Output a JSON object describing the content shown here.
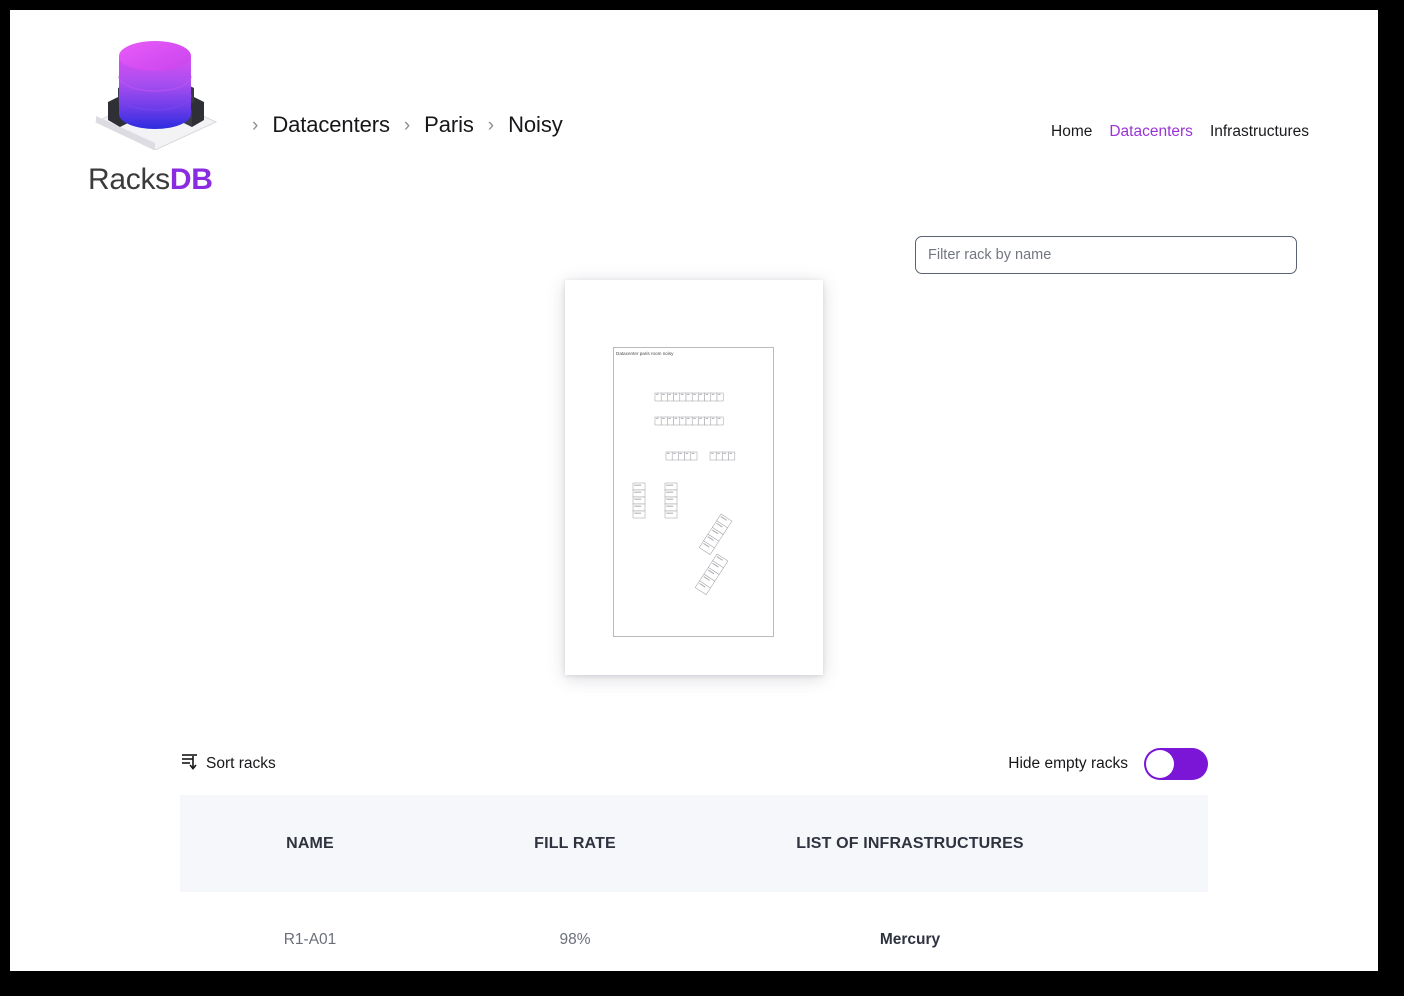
{
  "brand": {
    "name_prefix": "Racks",
    "name_suffix": "DB",
    "logo_icon": "database-cylinder-rack-icon",
    "accent_color": "#8a2be2"
  },
  "breadcrumb": {
    "separator": "›",
    "items": [
      {
        "label": "Datacenters"
      },
      {
        "label": "Paris"
      },
      {
        "label": "Noisy"
      }
    ]
  },
  "topnav": {
    "items": [
      {
        "label": "Home",
        "active": false
      },
      {
        "label": "Datacenters",
        "active": true
      },
      {
        "label": "Infrastructures",
        "active": false
      }
    ]
  },
  "filter": {
    "placeholder": "Filter rack by name",
    "value": ""
  },
  "floorplan": {
    "title": "Datacenter paris room noisy",
    "rows": [
      {
        "id": "row-top-1",
        "cells": 11,
        "orientation": "horizontal"
      },
      {
        "id": "row-top-2",
        "cells": 11,
        "orientation": "horizontal"
      },
      {
        "id": "row-mid-1",
        "cells": 5,
        "orientation": "horizontal"
      },
      {
        "id": "row-mid-2",
        "cells": 4,
        "orientation": "horizontal"
      },
      {
        "id": "col-left-1",
        "cells": 5,
        "orientation": "vertical"
      },
      {
        "id": "col-left-2",
        "cells": 5,
        "orientation": "vertical"
      },
      {
        "id": "diag-1",
        "cells": 5,
        "orientation": "diagonal"
      },
      {
        "id": "diag-2",
        "cells": 5,
        "orientation": "diagonal"
      }
    ]
  },
  "controls": {
    "sort_label": "Sort racks",
    "sort_icon": "sort-descending-icon",
    "hide_empty_label": "Hide empty racks",
    "hide_empty_on": true,
    "toggle_on_color": "#7b16d6"
  },
  "table": {
    "columns": [
      {
        "key": "name",
        "label": "NAME"
      },
      {
        "key": "fill",
        "label": "FILL RATE"
      },
      {
        "key": "infra",
        "label": "LIST OF INFRASTRUCTURES"
      }
    ],
    "rows": [
      {
        "name": "R1-A01",
        "fill": "98%",
        "infra": "Mercury"
      }
    ]
  }
}
